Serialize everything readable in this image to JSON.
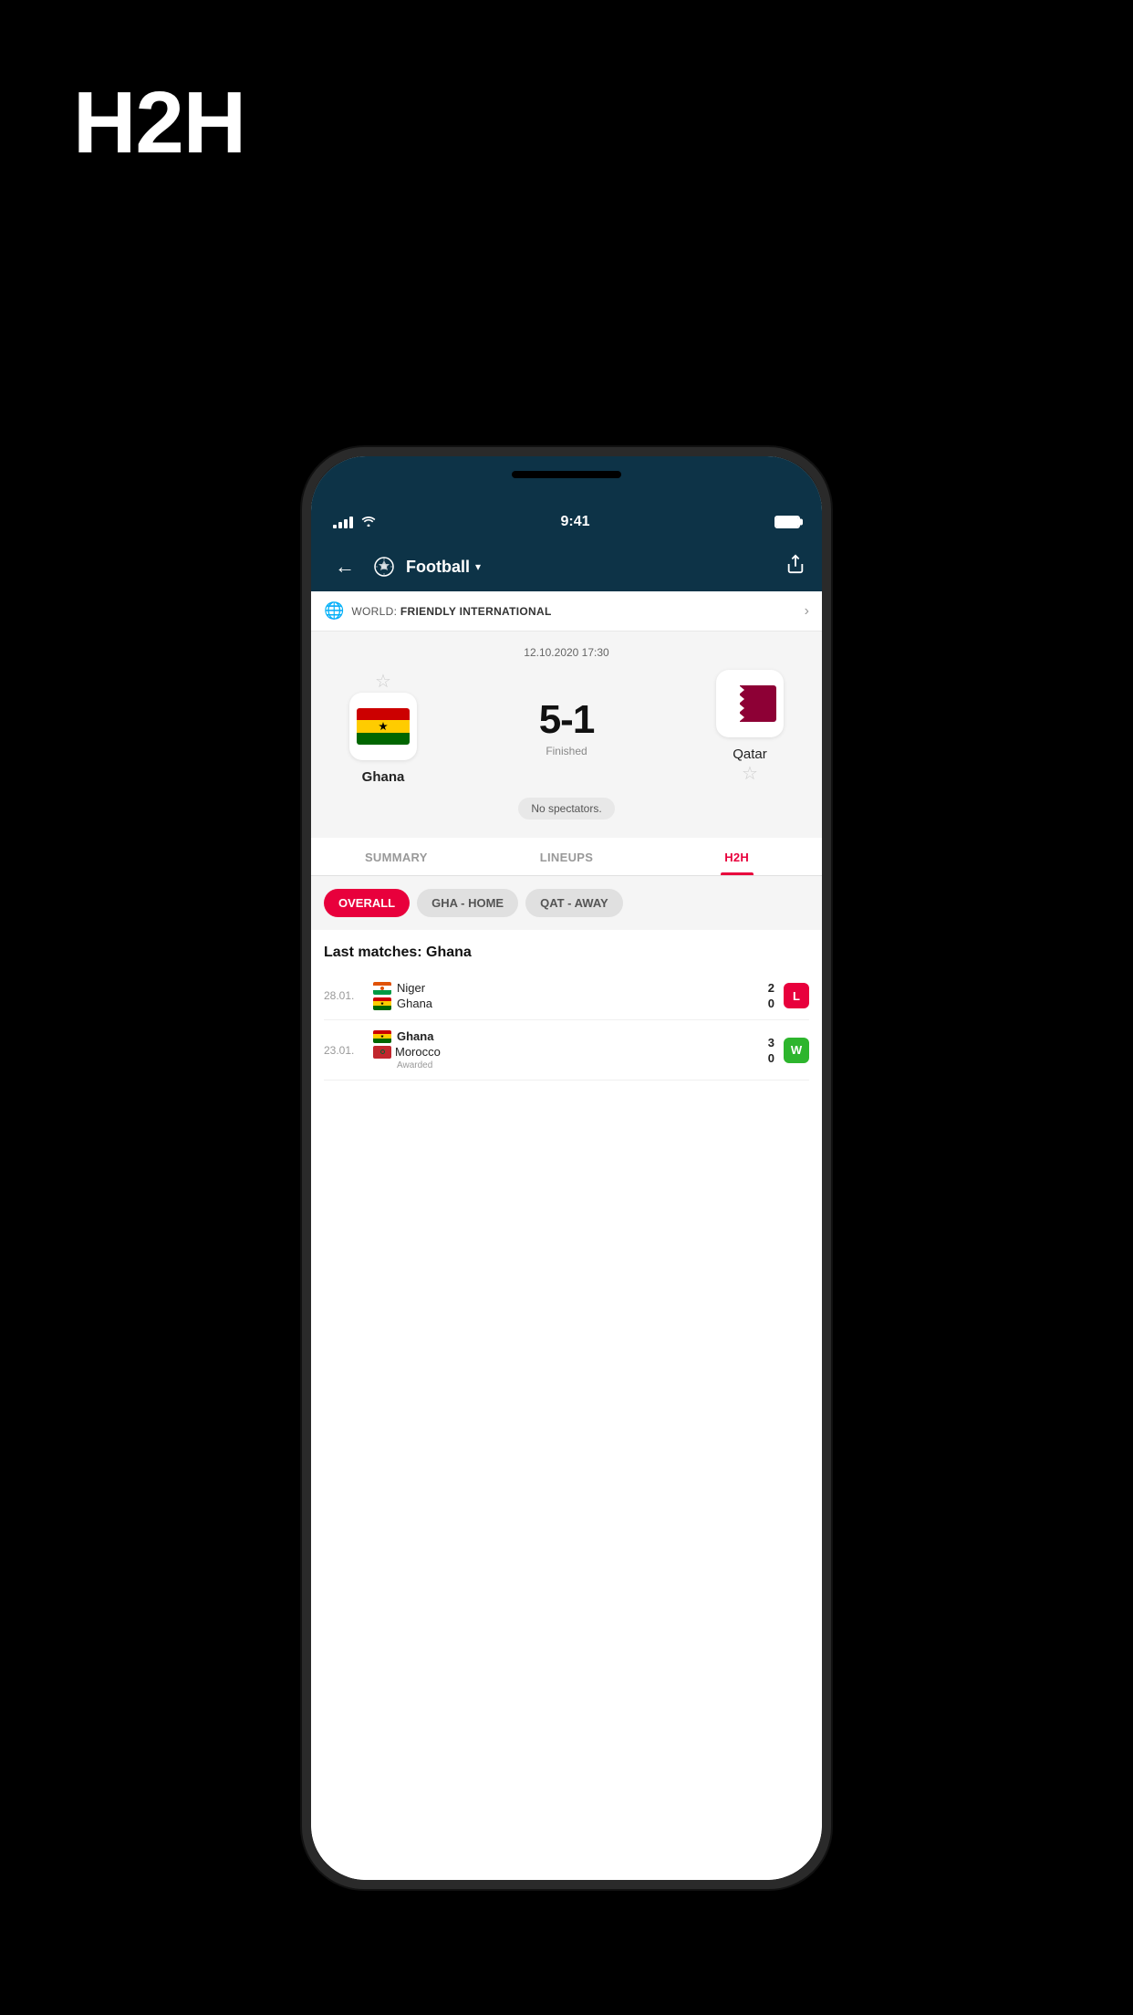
{
  "page": {
    "title": "H2H",
    "background": "#000000"
  },
  "status_bar": {
    "time": "9:41",
    "signal": "4 bars",
    "wifi": true,
    "battery": "full"
  },
  "nav": {
    "back_label": "←",
    "sport_label": "Football",
    "dropdown_arrow": "▾",
    "share_label": "⬆"
  },
  "league": {
    "flag": "🌐",
    "prefix": "WORLD: ",
    "name": "FRIENDLY INTERNATIONAL"
  },
  "match": {
    "date": "12.10.2020 17:30",
    "score": "5-1",
    "status": "Finished",
    "spectators": "No spectators.",
    "home_team": "Ghana",
    "away_team": "Qatar"
  },
  "tabs": [
    {
      "id": "summary",
      "label": "SUMMARY",
      "active": false
    },
    {
      "id": "lineups",
      "label": "LINEUPS",
      "active": false
    },
    {
      "id": "h2h",
      "label": "H2H",
      "active": true
    }
  ],
  "filters": [
    {
      "id": "overall",
      "label": "OVERALL",
      "active": true
    },
    {
      "id": "gha-home",
      "label": "GHA - HOME",
      "active": false
    },
    {
      "id": "qat-away",
      "label": "QAT - AWAY",
      "active": false
    }
  ],
  "last_matches_ghana": {
    "title": "Last matches: Ghana",
    "matches": [
      {
        "date": "28.01.",
        "team1": "Niger",
        "team1_flag": "niger",
        "team1_score": "2",
        "team2": "Ghana",
        "team2_flag": "ghana",
        "team2_score": "0",
        "result": "L"
      },
      {
        "date": "23.01.",
        "team1": "Ghana",
        "team1_flag": "ghana",
        "team1_score": "3",
        "team2": "Morocco",
        "team2_flag": "morocco",
        "team2_score": "0",
        "result": "W",
        "note": "Awarded"
      }
    ]
  }
}
